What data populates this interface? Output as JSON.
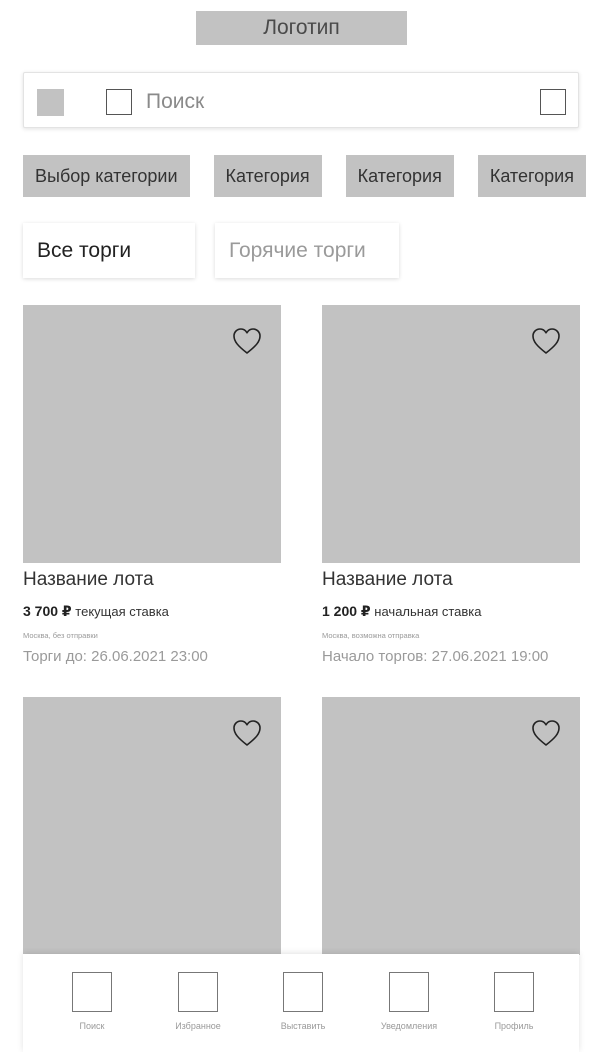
{
  "header": {
    "logo_text": "Логотип"
  },
  "search": {
    "placeholder": "Поиск",
    "value": ""
  },
  "categories": [
    "Выбор категории",
    "Категория",
    "Категория",
    "Категория"
  ],
  "tabs": [
    {
      "label": "Все торги",
      "active": true
    },
    {
      "label": "Горячие торги",
      "active": false
    }
  ],
  "lots": [
    {
      "title": "Название лота",
      "price": "3 700 ₽",
      "price_type": "текущая ставка",
      "location": "Москва, без отправки",
      "date": "Торги до: 26.06.2021 23:00"
    },
    {
      "title": "Название лота",
      "price": "1 200 ₽",
      "price_type": "начальная ставка",
      "location": "Москва, возможна отправка",
      "date": "Начало торгов: 27.06.2021 19:00"
    },
    {
      "title": "",
      "price": "",
      "price_type": "",
      "location": "",
      "date": ""
    },
    {
      "title": "",
      "price": "",
      "price_type": "",
      "location": "",
      "date": ""
    }
  ],
  "bottom_nav": [
    {
      "label": "Поиск",
      "icon": "search-icon"
    },
    {
      "label": "Избранное",
      "icon": "favorites-icon"
    },
    {
      "label": "Выставить",
      "icon": "add-lot-icon"
    },
    {
      "label": "Уведомления",
      "icon": "notifications-icon"
    },
    {
      "label": "Профиль",
      "icon": "profile-icon"
    }
  ],
  "colors": {
    "placeholder_gray": "#c2c2c2",
    "text_dark": "#222222",
    "text_muted": "#9a9a9a"
  }
}
